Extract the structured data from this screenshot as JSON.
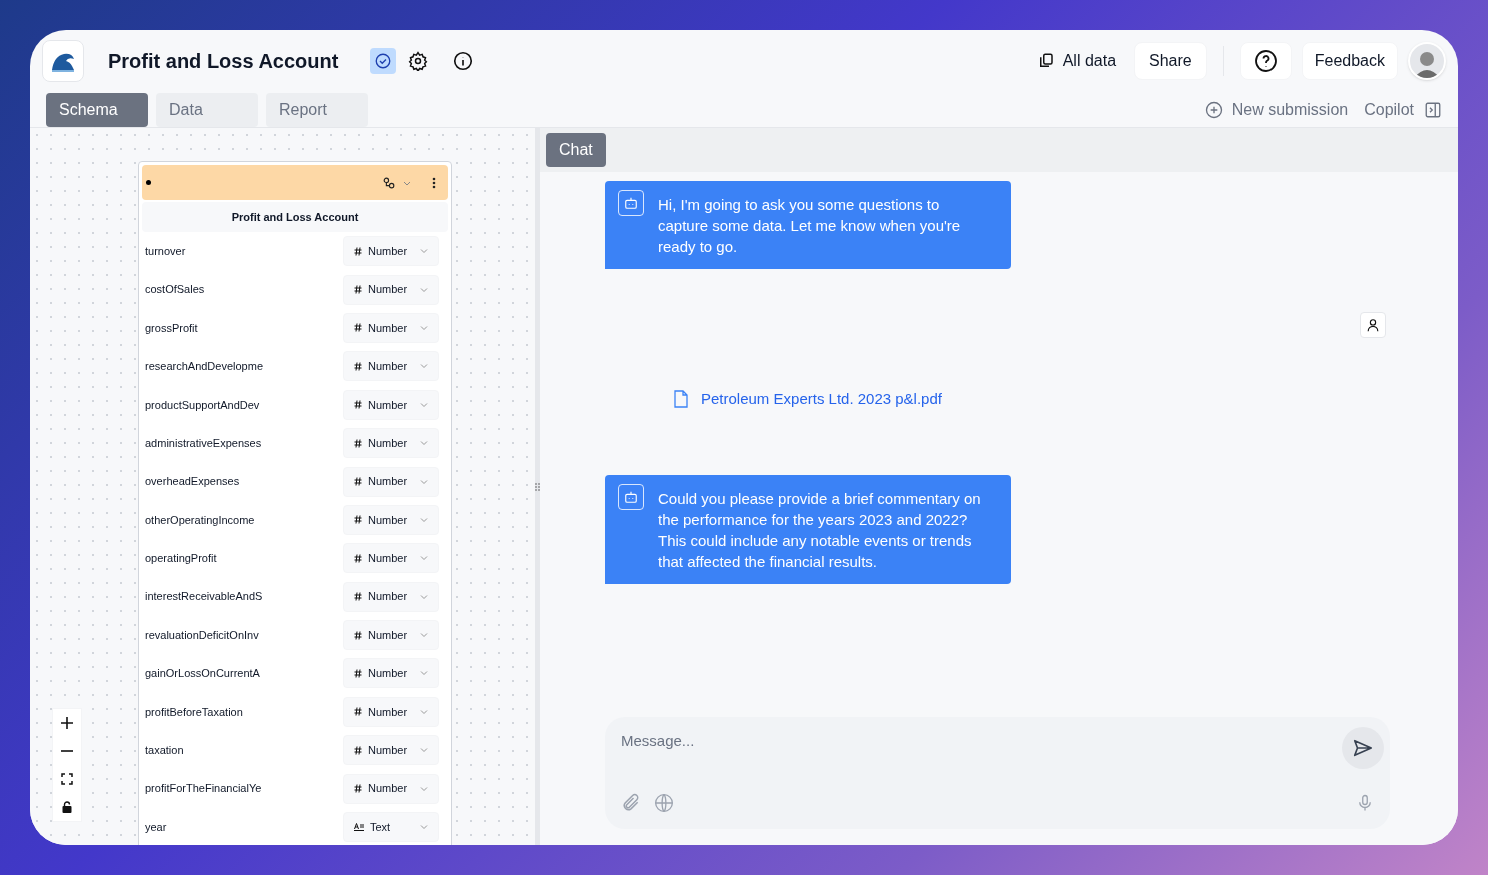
{
  "header": {
    "title": "Profit and Loss Account",
    "all_data": "All data",
    "share": "Share",
    "feedback": "Feedback"
  },
  "tabs": [
    {
      "label": "Schema",
      "selected": true
    },
    {
      "label": "Data",
      "selected": false
    },
    {
      "label": "Report",
      "selected": false
    }
  ],
  "actions": {
    "new_submission": "New submission",
    "copilot": "Copilot"
  },
  "schema_card": {
    "title": "Profit and Loss Account",
    "fields": [
      {
        "name": "turnover",
        "type": "Number",
        "kind": "number"
      },
      {
        "name": "costOfSales",
        "type": "Number",
        "kind": "number"
      },
      {
        "name": "grossProfit",
        "type": "Number",
        "kind": "number"
      },
      {
        "name": "researchAndDevelopme",
        "type": "Number",
        "kind": "number"
      },
      {
        "name": "productSupportAndDev",
        "type": "Number",
        "kind": "number"
      },
      {
        "name": "administrativeExpenses",
        "type": "Number",
        "kind": "number"
      },
      {
        "name": "overheadExpenses",
        "type": "Number",
        "kind": "number"
      },
      {
        "name": "otherOperatingIncome",
        "type": "Number",
        "kind": "number"
      },
      {
        "name": "operatingProfit",
        "type": "Number",
        "kind": "number"
      },
      {
        "name": "interestReceivableAndS",
        "type": "Number",
        "kind": "number"
      },
      {
        "name": "revaluationDeficitOnInv",
        "type": "Number",
        "kind": "number"
      },
      {
        "name": "gainOrLossOnCurrentA",
        "type": "Number",
        "kind": "number"
      },
      {
        "name": "profitBeforeTaxation",
        "type": "Number",
        "kind": "number"
      },
      {
        "name": "taxation",
        "type": "Number",
        "kind": "number"
      },
      {
        "name": "profitForTheFinancialYe",
        "type": "Number",
        "kind": "number"
      },
      {
        "name": "year",
        "type": "Text",
        "kind": "text"
      }
    ]
  },
  "chat": {
    "tab": "Chat",
    "messages": [
      {
        "kind": "bot",
        "text": "Hi, I'm going to ask you some questions to capture some data. Let me know when you're ready to go."
      },
      {
        "kind": "file",
        "name": "Petroleum Experts Ltd. 2023 p&l.pdf"
      },
      {
        "kind": "bot",
        "text": "Could you please provide a brief commentary on the performance for the years 2023 and 2022? This could include any notable events or trends that affected the financial results."
      }
    ],
    "input": {
      "placeholder": "Message..."
    }
  }
}
